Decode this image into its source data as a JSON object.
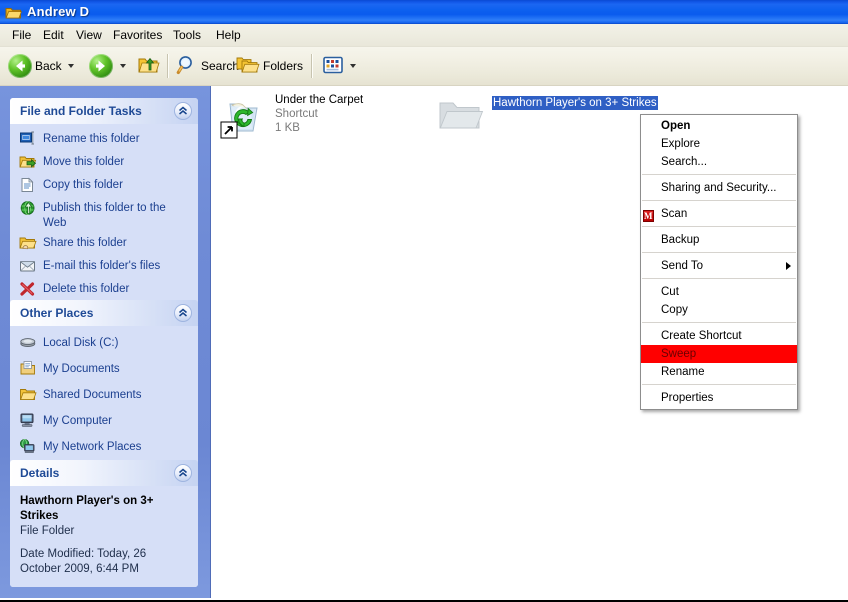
{
  "window": {
    "title": "Andrew D",
    "title_icon": "folder-icon"
  },
  "menubar": {
    "items": [
      {
        "label": "File"
      },
      {
        "label": "Edit"
      },
      {
        "label": "View"
      },
      {
        "label": "Favorites"
      },
      {
        "label": "Tools"
      },
      {
        "label": "Help"
      }
    ]
  },
  "toolbar": {
    "back_label": "Back",
    "search_label": "Search",
    "folders_label": "Folders",
    "icons": {
      "back": "back-arrow-icon",
      "forward": "forward-arrow-icon",
      "up": "up-folder-icon",
      "search": "magnifier-icon",
      "folders": "folders-icon",
      "views": "views-icon"
    }
  },
  "sidebar": {
    "panels": [
      {
        "title": "File and Folder Tasks",
        "collapse_icon": "chevron-up-icon",
        "items": [
          {
            "label": "Rename this folder",
            "icon": "rename-icon"
          },
          {
            "label": "Move this folder",
            "icon": "move-folder-icon"
          },
          {
            "label": "Copy this folder",
            "icon": "copy-icon"
          },
          {
            "label": "Publish this folder to the Web",
            "icon": "publish-web-icon"
          },
          {
            "label": "Share this folder",
            "icon": "share-folder-icon"
          },
          {
            "label": "E-mail this folder's files",
            "icon": "email-icon"
          },
          {
            "label": "Delete this folder",
            "icon": "delete-x-icon"
          }
        ]
      },
      {
        "title": "Other Places",
        "collapse_icon": "chevron-up-icon",
        "items": [
          {
            "label": "Local Disk (C:)",
            "icon": "hard-disk-icon"
          },
          {
            "label": "My Documents",
            "icon": "my-documents-icon"
          },
          {
            "label": "Shared Documents",
            "icon": "shared-documents-icon"
          },
          {
            "label": "My Computer",
            "icon": "my-computer-icon"
          },
          {
            "label": "My Network Places",
            "icon": "network-places-icon"
          }
        ]
      },
      {
        "title": "Details",
        "collapse_icon": "chevron-up-icon",
        "name": "Hawthorn Player's on 3+ Strikes",
        "type": "File Folder",
        "date_modified": "Date Modified: Today, 26 October 2009, 6:44 PM"
      }
    ]
  },
  "content": {
    "items": [
      {
        "name": "Under the Carpet",
        "type": "Shortcut",
        "size": "1 KB",
        "icon": "recycle-bin-shortcut-icon",
        "selected": false
      },
      {
        "name": "Hawthorn Player's on 3+ Strikes",
        "type": "",
        "size": "",
        "icon": "folder-cut-icon",
        "selected": true
      }
    ]
  },
  "context_menu": {
    "items": [
      {
        "label": "Open",
        "bold": true,
        "kind": "item"
      },
      {
        "label": "Explore",
        "bold": false,
        "kind": "item"
      },
      {
        "label": "Search...",
        "bold": false,
        "kind": "item"
      },
      {
        "kind": "separator"
      },
      {
        "label": "Sharing and Security...",
        "bold": false,
        "kind": "item"
      },
      {
        "kind": "separator"
      },
      {
        "label": "Scan",
        "bold": false,
        "kind": "item",
        "icon": "mcafee-scan-icon"
      },
      {
        "kind": "separator"
      },
      {
        "label": "Backup",
        "bold": false,
        "kind": "item"
      },
      {
        "kind": "separator"
      },
      {
        "label": "Send To",
        "bold": false,
        "kind": "submenu"
      },
      {
        "kind": "separator"
      },
      {
        "label": "Cut",
        "bold": false,
        "kind": "item"
      },
      {
        "label": "Copy",
        "bold": false,
        "kind": "item"
      },
      {
        "kind": "separator"
      },
      {
        "label": "Create Shortcut",
        "bold": false,
        "kind": "item"
      },
      {
        "label": "Sweep",
        "bold": false,
        "kind": "item",
        "selected": true
      },
      {
        "label": "Rename",
        "bold": false,
        "kind": "item"
      },
      {
        "kind": "separator"
      },
      {
        "label": "Properties",
        "bold": false,
        "kind": "item"
      }
    ]
  },
  "colors": {
    "titlebar_blue": "#0e61ef",
    "sidebar_blue": "#6f8bd6",
    "panel_body": "#d6dff7",
    "panel_title_text": "#1f4a96",
    "link_text": "#1b3f8f",
    "selection_blue": "#2f5fc4",
    "menu_highlight_red": "#ff0000",
    "toolbar_beige": "#eceadb"
  }
}
